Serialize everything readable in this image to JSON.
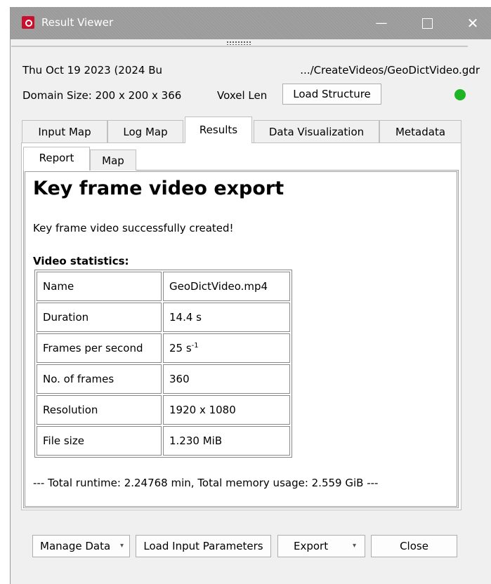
{
  "window": {
    "title": "Result Viewer",
    "minimize_glyph": "—",
    "close_glyph": "✕"
  },
  "header": {
    "date": "Thu Oct 19 2023 (2024 Bu",
    "path": ".../CreateVideos/GeoDictVideo.gdr",
    "domain_size": "Domain Size: 200 x 200 x 366",
    "voxel_len": "Voxel Len",
    "load_structure_label": "Load Structure",
    "status_color": "#1db524"
  },
  "tabs": [
    {
      "label": "Input Map"
    },
    {
      "label": "Log Map"
    },
    {
      "label": "Results"
    },
    {
      "label": "Data Visualization"
    },
    {
      "label": "Metadata"
    }
  ],
  "subtabs": [
    {
      "label": "Report"
    },
    {
      "label": "Map"
    }
  ],
  "report": {
    "title": "Key frame video export",
    "message": "Key frame video successfully created!",
    "stats_title": "Video statistics:",
    "rows": [
      {
        "key": "Name",
        "value": "GeoDictVideo.mp4"
      },
      {
        "key": "Duration",
        "value": "14.4 s"
      },
      {
        "key": "Frames per second",
        "value": "25 s",
        "sup": "-1"
      },
      {
        "key": "No. of frames",
        "value": "360"
      },
      {
        "key": "Resolution",
        "value": "1920 x 1080"
      },
      {
        "key": "File size",
        "value": "1.230 MiB"
      }
    ],
    "runtime": "--- Total runtime: 2.24768 min, Total memory usage: 2.559 GiB ---"
  },
  "footer": {
    "manage_data": "Manage Data",
    "load_input_params": "Load Input Parameters",
    "export": "Export",
    "close": "Close",
    "dropdown_caret": "▾"
  }
}
